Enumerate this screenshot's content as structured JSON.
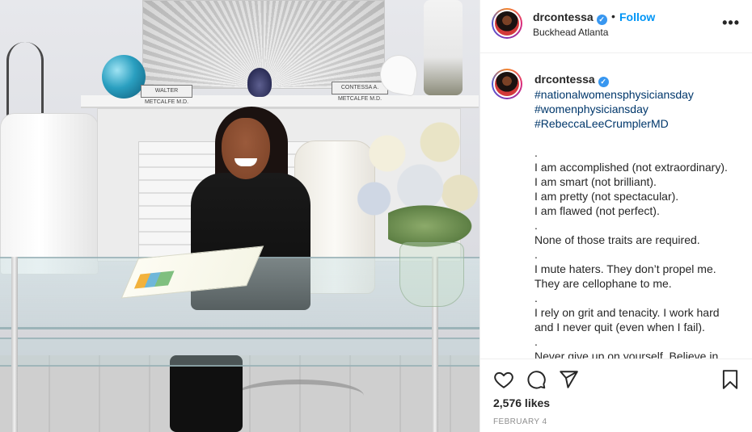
{
  "post": {
    "username": "drcontessa",
    "verified_mark": "✓",
    "dot": "•",
    "follow_label": "Follow",
    "location": "Buckhead Atlanta",
    "more_label": "•••",
    "likes": "2,576 likes",
    "date": "FEBRUARY 4"
  },
  "photo": {
    "nameplate_left": "WALTER METCALFE M.D.",
    "nameplate_right": "CONTESSA A. METCALFE M.D."
  },
  "caption": {
    "username": "drcontessa",
    "lines": [
      {
        "text": "#nationalwomensphysiciansday",
        "type": "tag"
      },
      {
        "text": "#womenphysiciansday",
        "type": "tag"
      },
      {
        "text": "#RebeccaLeeCrumplerMD",
        "type": "tag"
      },
      {
        "text": "",
        "type": "text"
      },
      {
        "text": ".",
        "type": "text"
      },
      {
        "text": "I am accomplished (not extraordinary).",
        "type": "text"
      },
      {
        "text": "I am smart (not brilliant).",
        "type": "text"
      },
      {
        "text": "I am pretty (not spectacular).",
        "type": "text"
      },
      {
        "text": "I am flawed (not perfect).",
        "type": "text"
      },
      {
        "text": ".",
        "type": "text"
      },
      {
        "text": "None of those traits are required.",
        "type": "text"
      },
      {
        "text": ".",
        "type": "text"
      },
      {
        "text": "I mute haters. They don’t propel me.",
        "type": "text"
      },
      {
        "text": "They are cellophane to me.",
        "type": "text"
      },
      {
        "text": ".",
        "type": "text"
      },
      {
        "text": "I rely on grit and tenacity. I work hard",
        "type": "text"
      },
      {
        "text": "and I never quit (even when I fail).",
        "type": "text"
      },
      {
        "text": ".",
        "type": "text"
      },
      {
        "text": "Never give up on yourself. Believe in",
        "type": "text"
      }
    ]
  },
  "icons": {
    "like": "heart-icon",
    "comment": "comment-icon",
    "share": "share-icon",
    "save": "bookmark-icon"
  },
  "colors": {
    "follow": "#0095f6",
    "hashtag": "#00376b",
    "verified": "#3897f0",
    "muted": "#8e8e8e"
  }
}
